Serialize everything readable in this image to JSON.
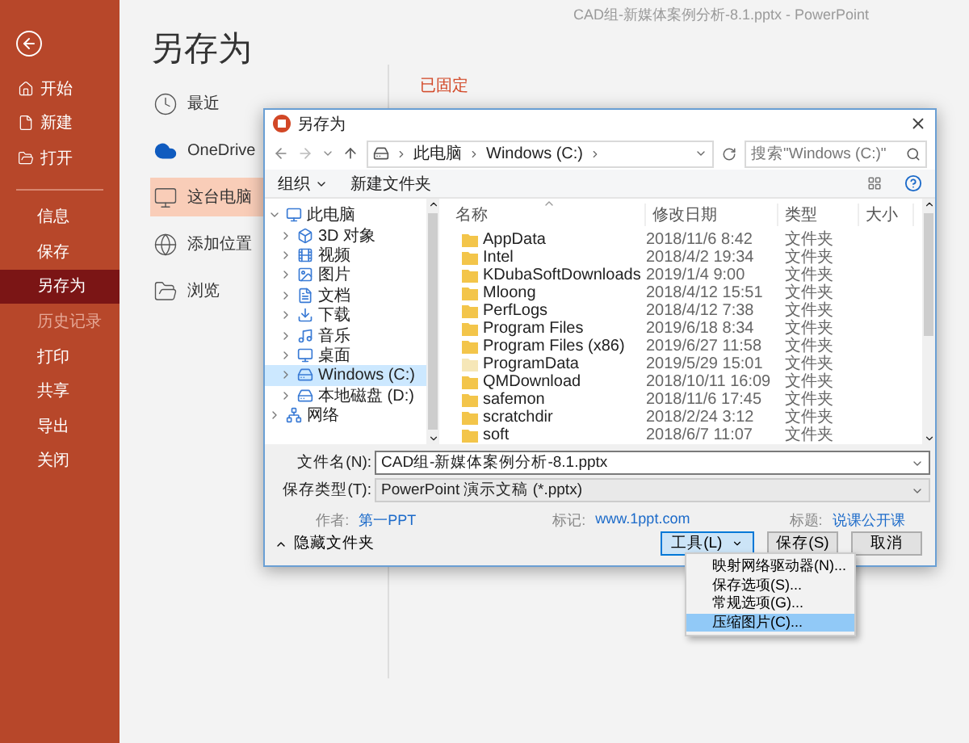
{
  "app": {
    "title": "CAD组-新媒体案例分析-8.1.pptx  -  PowerPoint"
  },
  "sidebar": {
    "top_items": [
      {
        "label": "开始"
      },
      {
        "label": "新建"
      },
      {
        "label": "打开"
      }
    ],
    "items": [
      {
        "label": "信息",
        "selected": false,
        "disabled": false
      },
      {
        "label": "保存",
        "selected": false,
        "disabled": false
      },
      {
        "label": "另存为",
        "selected": true,
        "disabled": false
      },
      {
        "label": "历史记录",
        "selected": false,
        "disabled": true
      },
      {
        "label": "打印",
        "selected": false,
        "disabled": false
      },
      {
        "label": "共享",
        "selected": false,
        "disabled": false
      },
      {
        "label": "导出",
        "selected": false,
        "disabled": false
      },
      {
        "label": "关闭",
        "selected": false,
        "disabled": false
      }
    ]
  },
  "page": {
    "title": "另存为",
    "pinned_heading": "已固定"
  },
  "locations": [
    {
      "label": "最近",
      "selected": false
    },
    {
      "label": "OneDrive",
      "selected": false
    },
    {
      "label": "这台电脑",
      "selected": true
    },
    {
      "label": "添加位置",
      "selected": false
    },
    {
      "label": "浏览",
      "selected": false
    }
  ],
  "dialog": {
    "title": "另存为",
    "address": [
      "此电脑",
      "Windows (C:)"
    ],
    "search": {
      "placeholder": "搜索\"Windows (C:)\""
    },
    "toolbar": {
      "organize": "组织",
      "new_folder": "新建文件夹"
    },
    "tree": [
      {
        "label": "此电脑",
        "expanded": true,
        "selected": false,
        "children": [
          {
            "label": "3D 对象",
            "expanded": false,
            "selected": false
          },
          {
            "label": "视频",
            "expanded": false,
            "selected": false
          },
          {
            "label": "图片",
            "expanded": false,
            "selected": false
          },
          {
            "label": "文档",
            "expanded": false,
            "selected": false
          },
          {
            "label": "下载",
            "expanded": false,
            "selected": false
          },
          {
            "label": "音乐",
            "expanded": false,
            "selected": false
          },
          {
            "label": "桌面",
            "expanded": false,
            "selected": false
          },
          {
            "label": "Windows (C:)",
            "expanded": false,
            "selected": true
          },
          {
            "label": "本地磁盘 (D:)",
            "expanded": false,
            "selected": false
          }
        ]
      },
      {
        "label": "网络",
        "expanded": false,
        "selected": false
      }
    ],
    "columns": [
      "名称",
      "修改日期",
      "类型",
      "大小"
    ],
    "rows": [
      {
        "name": "AppData",
        "modified": "2018/11/6 8:42",
        "type": "文件夹",
        "hidden": false
      },
      {
        "name": "Intel",
        "modified": "2018/4/2 19:34",
        "type": "文件夹",
        "hidden": false
      },
      {
        "name": "KDubaSoftDownloads",
        "modified": "2019/1/4 9:00",
        "type": "文件夹",
        "hidden": false
      },
      {
        "name": "Mloong",
        "modified": "2018/4/12 15:51",
        "type": "文件夹",
        "hidden": false
      },
      {
        "name": "PerfLogs",
        "modified": "2018/4/12 7:38",
        "type": "文件夹",
        "hidden": false
      },
      {
        "name": "Program Files",
        "modified": "2019/6/18 8:34",
        "type": "文件夹",
        "hidden": false
      },
      {
        "name": "Program Files (x86)",
        "modified": "2019/6/27 11:58",
        "type": "文件夹",
        "hidden": false
      },
      {
        "name": "ProgramData",
        "modified": "2019/5/29 15:01",
        "type": "文件夹",
        "hidden": true
      },
      {
        "name": "QMDownload",
        "modified": "2018/10/11 16:09",
        "type": "文件夹",
        "hidden": false
      },
      {
        "name": "safemon",
        "modified": "2018/11/6 17:45",
        "type": "文件夹",
        "hidden": false
      },
      {
        "name": "scratchdir",
        "modified": "2018/2/24 3:12",
        "type": "文件夹",
        "hidden": false
      },
      {
        "name": "soft",
        "modified": "2018/6/7 11:07",
        "type": "文件夹",
        "hidden": false
      }
    ],
    "file_name": {
      "label": "文件名(N):",
      "value": "CAD组-新媒体案例分析-8.1.pptx"
    },
    "save_type": {
      "label": "保存类型(T):",
      "value": "PowerPoint 演示文稿 (*.pptx)"
    },
    "meta": [
      {
        "label": "作者:",
        "value": "第一PPT"
      },
      {
        "label": "标记:",
        "value": "www.1ppt.com"
      },
      {
        "label": "标题:",
        "value": "说课公开课"
      }
    ],
    "hide_folders": "隐藏文件夹",
    "buttons": {
      "tools": "工具(L)",
      "save": "保存(S)",
      "cancel": "取消"
    },
    "tools_menu": [
      {
        "label": "映射网络驱动器(N)...",
        "selected": false
      },
      {
        "label": "保存选项(S)...",
        "selected": false
      },
      {
        "label": "常规选项(G)...",
        "selected": false
      },
      {
        "label": "压缩图片(C)...",
        "selected": true
      }
    ]
  }
}
